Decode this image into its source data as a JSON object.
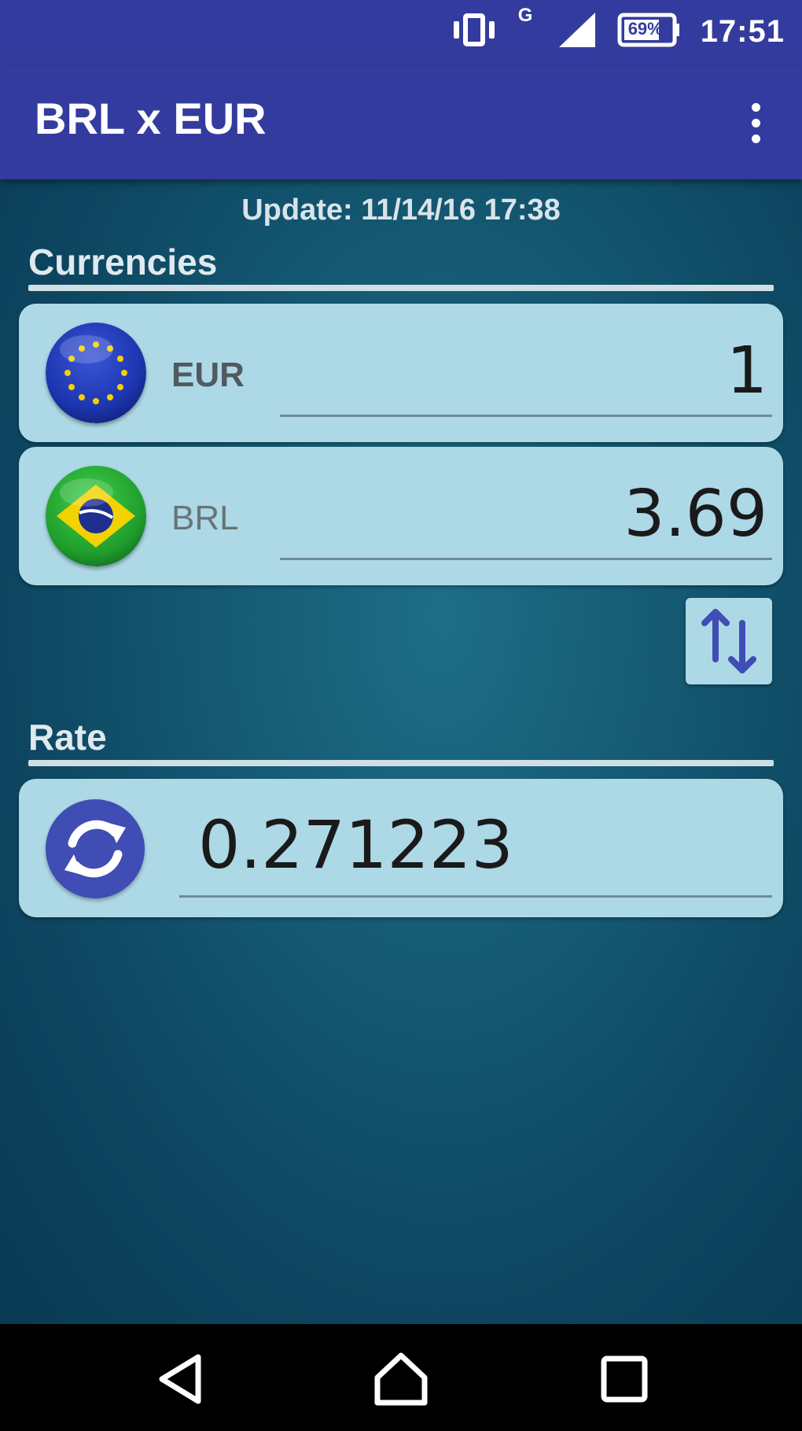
{
  "status_bar": {
    "time": "17:51",
    "network_type": "G",
    "battery_text": "69%",
    "icons": [
      "vibrate-icon",
      "network-type-icon",
      "signal-icon",
      "battery-icon"
    ]
  },
  "app_bar": {
    "title": "BRL x EUR",
    "menu_icon": "overflow-menu-icon"
  },
  "update": {
    "text": "Update: 11/14/16 17:38"
  },
  "currencies": {
    "section_title": "Currencies",
    "from": {
      "code": "EUR",
      "value": "1",
      "flag_icon": "eu-flag-icon"
    },
    "to": {
      "code": "BRL",
      "value": "3.69",
      "flag_icon": "brazil-flag-icon"
    },
    "swap_icon": "swap-arrows-icon"
  },
  "rate": {
    "section_title": "Rate",
    "value": "0.271223",
    "refresh_icon": "refresh-icon"
  },
  "nav_bar": {
    "icons": [
      "back-icon",
      "home-icon",
      "recents-icon"
    ]
  },
  "colors": {
    "primary": "#333c9e",
    "card": "#add8e6",
    "accent_icon": "#3f4db4",
    "background_center": "#1e6e86",
    "background_edge": "#093a55"
  }
}
